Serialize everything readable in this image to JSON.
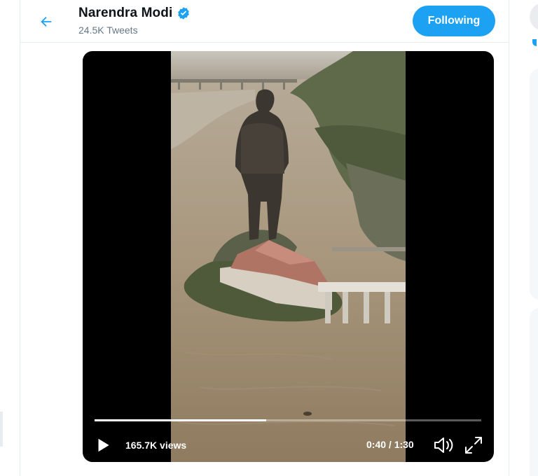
{
  "header": {
    "back_icon": "arrow-left-icon",
    "name": "Narendra Modi",
    "verified_icon": "verified-badge-icon",
    "tweet_count": "24.5K Tweets",
    "follow_label": "Following"
  },
  "video": {
    "views": "165.7K views",
    "time": "0:40 / 1:30",
    "progress": 0.444,
    "play_icon": "play-icon",
    "volume_icon": "volume-icon",
    "fullscreen_icon": "fullscreen-icon"
  },
  "colors": {
    "accent": "#1da1f2",
    "border": "#e6ecf0",
    "secondary_text": "#657786"
  }
}
